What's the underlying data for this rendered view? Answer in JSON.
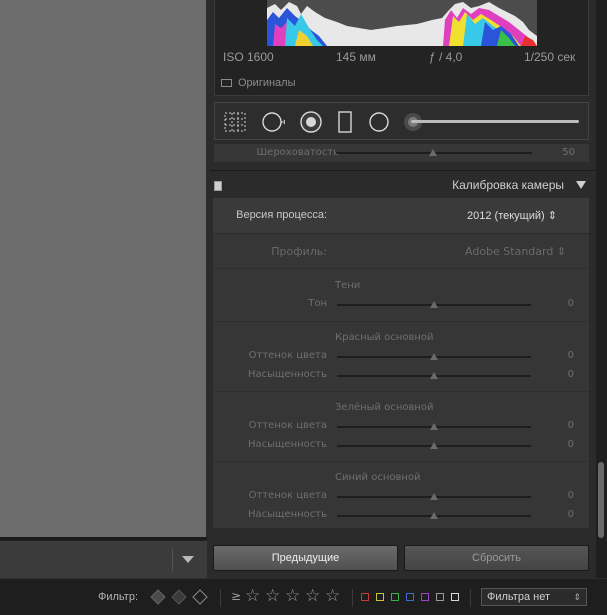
{
  "histogram": {
    "iso": "ISO 1600",
    "focal": "145 мм",
    "aperture": "ƒ / 4,0",
    "shutter": "1/250 сек",
    "originals_label": "Оригиналы"
  },
  "previous_section": {
    "label": "Шероховатость",
    "value": "50"
  },
  "calibration": {
    "title": "Калибровка камеры",
    "process_label": "Версия процесса:",
    "process_value": "2012 (текущий) ⇕",
    "profile_label": "Профиль:",
    "profile_value": "Adobe Standard ⇕",
    "shadows": {
      "title": "Тени",
      "tone_label": "Тон",
      "tone_value": "0"
    },
    "red": {
      "title": "Красный основной",
      "hue_label": "Оттенок цвета",
      "hue_value": "0",
      "sat_label": "Насыщенность",
      "sat_value": "0"
    },
    "green": {
      "title": "Зелёный основной",
      "hue_label": "Оттенок цвета",
      "hue_value": "0",
      "sat_label": "Насыщенность",
      "sat_value": "0"
    },
    "blue": {
      "title": "Синий основной",
      "hue_label": "Оттенок цвета",
      "hue_value": "0",
      "sat_label": "Насыщенность",
      "sat_value": "0"
    }
  },
  "buttons": {
    "previous": "Предыдущие",
    "reset": "Сбросить"
  },
  "filter_bar": {
    "label": "Фильтр:",
    "geq": "≥",
    "stars": [
      "☆",
      "☆",
      "☆",
      "☆",
      "☆"
    ],
    "color_labels": [
      "#c63a3a",
      "#c9c13a",
      "#3eb04a",
      "#3f6ad6",
      "#9a48c9",
      "#9a9a9a",
      "#d9d9d9"
    ],
    "preset_value": "Фильтра нет"
  },
  "colors": {
    "panel_bg": "#2b2b2b",
    "canvas_bg": "#6c6c6c",
    "accent_text": "#cfcfcf"
  }
}
